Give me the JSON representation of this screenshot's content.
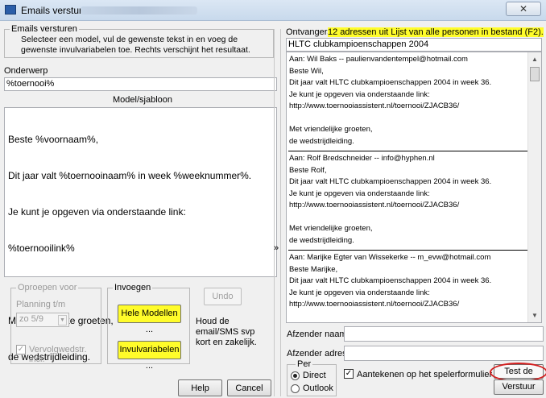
{
  "window": {
    "title": "Emails versturen",
    "close_glyph": "✕"
  },
  "left": {
    "group_title": "Emails versturen",
    "instructions": "Selecteer een model, vul de gewenste tekst in en voeg de gewenste invulvariabelen toe. Rechts verschijnt het resultaat.",
    "subject_label": "Onderwerp",
    "subject_value": "%toernooi%",
    "template_label": "Model/sjabloon",
    "template_lines": [
      "Beste %voornaam%,",
      "Dit jaar valt %toernooinaam% in week %weeknummer%.",
      "Je kunt je opgeven via onderstaande link:",
      "%toernooilink%",
      "",
      "Met vriendelijke groeten,",
      "de wedstrijdleiding."
    ]
  },
  "oproepen": {
    "group_title": "Oproepen voor",
    "planning_label": "Planning t/m",
    "planning_value": "zo 5/9",
    "vervolg_label": "Vervolgwedstr. incl.",
    "vervolg_checked": "✓"
  },
  "invoegen": {
    "group_title": "Invoegen",
    "models_button": "Hele Modellen ...",
    "variables_button": "Invulvariabelen ..."
  },
  "undo_button": "Undo",
  "hint_text": "Houd de email/SMS svp kort en zakelijk.",
  "help_button": "Help",
  "cancel_button": "Cancel",
  "expand_glyph": "»",
  "right": {
    "recipients_label": "Ontvangers",
    "recipients_count": "12 adressen uit Lijst van alle personen in bestand (F2).",
    "tournament_name": "HLTC clubkampioenschappen 2004",
    "messages": [
      {
        "lines": [
          "Aan: Wil Baks -- paulienvandentempel@hotmail.com",
          "Beste Wil,",
          "Dit jaar valt HLTC clubkampioenschappen 2004 in week 36.",
          "Je kunt je opgeven via onderstaande link:",
          "http://www.toernooiassistent.nl/toernooi/ZJACB36/",
          "",
          "Met vriendelijke groeten,",
          "de wedstrijdleiding."
        ]
      },
      {
        "lines": [
          "Aan: Rolf Bredschneider -- info@hyphen.nl",
          "Beste Rolf,",
          "Dit jaar valt HLTC clubkampioenschappen 2004 in week 36.",
          "Je kunt je opgeven via onderstaande link:",
          "http://www.toernooiassistent.nl/toernooi/ZJACB36/",
          "",
          "Met vriendelijke groeten,",
          "de wedstrijdleiding."
        ]
      },
      {
        "lines": [
          "Aan: Marijke Egter van Wissekerke -- m_evw@hotmail.com",
          "Beste Marijke,",
          "Dit jaar valt HLTC clubkampioenschappen 2004 in week 36.",
          "Je kunt je opgeven via onderstaande link:",
          "http://www.toernooiassistent.nl/toernooi/ZJACB36/"
        ]
      }
    ],
    "sender_name_label": "Afzender naam",
    "sender_name_value": "",
    "sender_address_label": "Afzender adres",
    "sender_address_value": ""
  },
  "per": {
    "group_title": "Per",
    "direct_label": "Direct",
    "outlook_label": "Outlook"
  },
  "note_checkbox_label": "Aantekenen op het spelerformulier",
  "note_checked": "✓",
  "test_email_button": "Test de email",
  "send_button": "Verstuur",
  "colors": {
    "highlight": "#fffc2a",
    "annotation_red": "#d41f1f"
  }
}
